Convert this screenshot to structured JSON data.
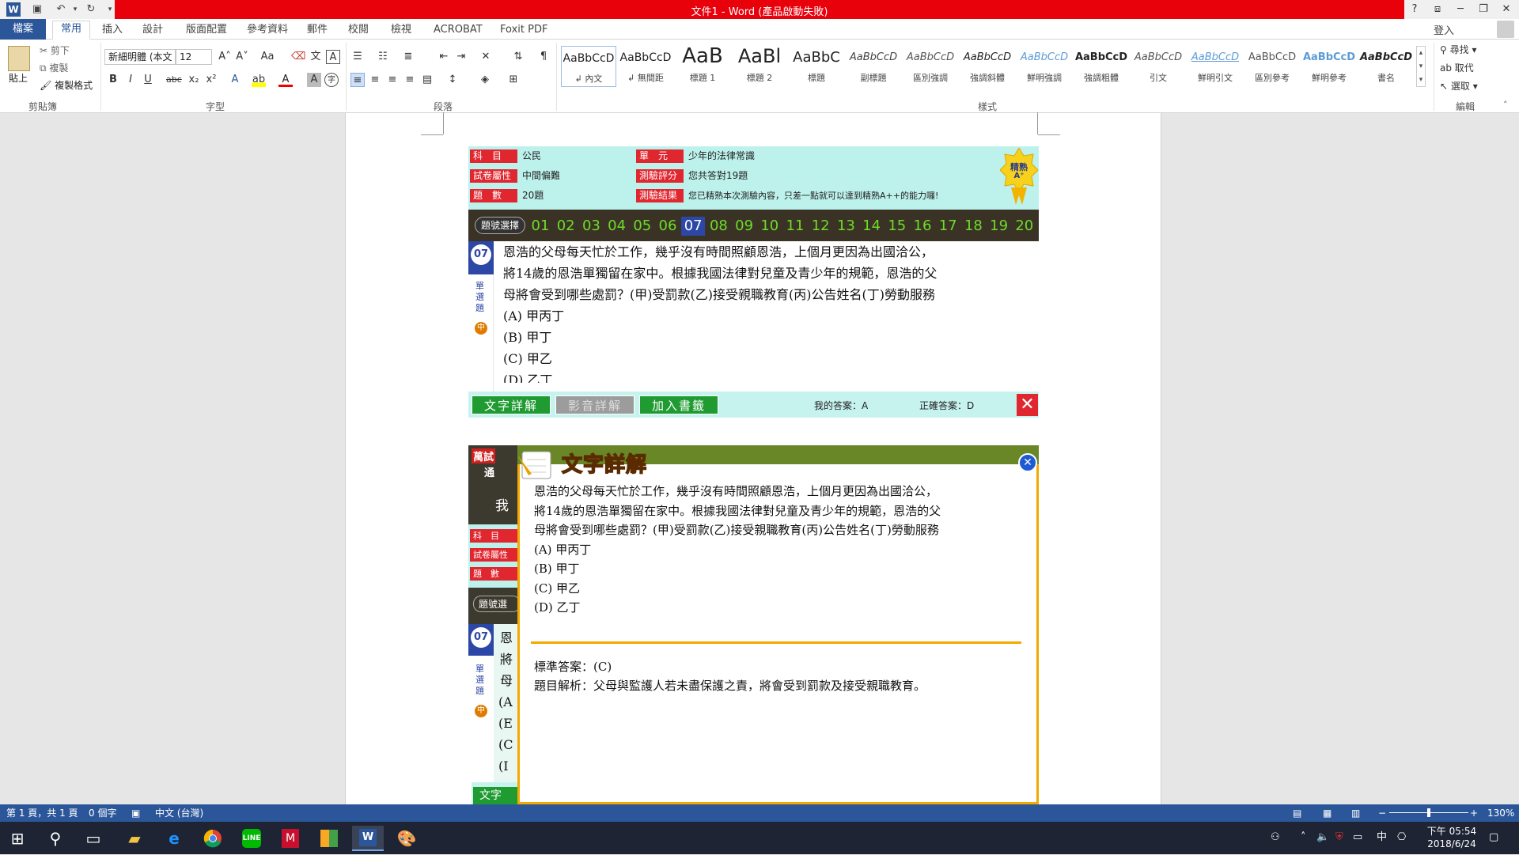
{
  "app": {
    "title": "文件1 - Word (產品啟動失敗)",
    "help": "?",
    "sign_in": "登入"
  },
  "tabs": [
    {
      "label": "檔案"
    },
    {
      "label": "常用"
    },
    {
      "label": "插入"
    },
    {
      "label": "設計"
    },
    {
      "label": "版面配置"
    },
    {
      "label": "參考資料"
    },
    {
      "label": "郵件"
    },
    {
      "label": "校閱"
    },
    {
      "label": "檢視"
    },
    {
      "label": "ACROBAT"
    },
    {
      "label": "Foxit PDF"
    }
  ],
  "ribbon": {
    "clipboard": {
      "paste": "貼上",
      "cut": "剪下",
      "copy": "複製",
      "format_painter": "複製格式",
      "label": "剪貼簿"
    },
    "font": {
      "name": "新細明體 (本文",
      "size": "12",
      "case": "Aa",
      "label": "字型"
    },
    "paragraph": {
      "label": "段落"
    },
    "styles": {
      "label": "樣式",
      "items": [
        {
          "preview": "AaBbCcD",
          "name": "↲ 內文"
        },
        {
          "preview": "AaBbCcD",
          "name": "↲ 無間距"
        },
        {
          "preview": "AaB",
          "name": "標題 1"
        },
        {
          "preview": "AaBl",
          "name": "標題 2"
        },
        {
          "preview": "AaBbC",
          "name": "標題"
        },
        {
          "preview": "AaBbCcD",
          "name": "副標題"
        },
        {
          "preview": "AaBbCcD",
          "name": "區別強調"
        },
        {
          "preview": "AaBbCcD",
          "name": "強調斜體"
        },
        {
          "preview": "AaBbCcD",
          "name": "鮮明強調"
        },
        {
          "preview": "AaBbCcD",
          "name": "強調粗體"
        },
        {
          "preview": "AaBbCcD",
          "name": "引文"
        },
        {
          "preview": "AaBbCcD",
          "name": "鮮明引文"
        },
        {
          "preview": "AaBbCcD",
          "name": "區別參考"
        },
        {
          "preview": "AaBbCcD",
          "name": "鮮明參考"
        },
        {
          "preview": "AaBbCcD",
          "name": "書名"
        }
      ]
    },
    "editing": {
      "find": "尋找",
      "replace": "取代",
      "select": "選取",
      "label": "編輯"
    }
  },
  "quiz": {
    "info": {
      "subject_label": "科　目",
      "subject": "公民",
      "unit_label": "單　元",
      "unit": "少年的法律常識",
      "level_label": "試卷屬性",
      "level": "中間偏難",
      "score_label": "測驗評分",
      "score": "您共答對19題",
      "count_label": "題　數",
      "count": "20題",
      "result_label": "測驗結果",
      "result": "您已精熟本次測驗內容，只差一點就可以達到精熟A++的能力囉!",
      "badge": "精熟",
      "badge_grade": "A⁺"
    },
    "select_label": "題號選擇",
    "numbers": [
      "01",
      "02",
      "03",
      "04",
      "05",
      "06",
      "07",
      "08",
      "09",
      "10",
      "11",
      "12",
      "13",
      "14",
      "15",
      "16",
      "17",
      "18",
      "19",
      "20"
    ],
    "current": "07",
    "qnum": "07",
    "qtype": "單選題",
    "difficulty": "中",
    "question_lines": [
      "恩浩的父母每天忙於工作，幾乎沒有時間照顧恩浩，上個月更因為出國洽公，",
      "將14歲的恩浩單獨留在家中。根據我國法律對兒童及青少年的規範，恩浩的父",
      "母將會受到哪些處罰？(甲)受罰款(乙)接受親職教育(丙)公告姓名(丁)勞動服務"
    ],
    "options": [
      "(A) 甲丙丁",
      "(B) 甲丁",
      "(C) 甲乙",
      "(D) 乙丁"
    ],
    "btn_text": "文字詳解",
    "btn_video": "影音詳解",
    "btn_bookmark": "加入書籤",
    "my_answer": "我的答案：A",
    "correct_answer": "正確答案：D"
  },
  "popup": {
    "title": "文字詳解",
    "question_lines": [
      "恩浩的父母每天忙於工作，幾乎沒有時間照顧恩浩，上個月更因為出國洽公，",
      "將14歲的恩浩單獨留在家中。根據我國法律對兒童及青少年的規範，恩浩的父",
      "母將會受到哪些處罰？(甲)受罰款(乙)接受親職教育(丙)公告姓名(丁)勞動服務"
    ],
    "options": [
      "(A) 甲丙丁",
      "(B) 甲丁",
      "(C) 甲乙",
      "(D) 乙丁"
    ],
    "answer": "標準答案：(C)",
    "analysis": "題目解析：父母與監護人若未盡保護之責，將會受到罰款及接受親職教育。",
    "bg_fragments": [
      "萬試",
      "通",
      "我",
      "科　目",
      "試卷屬性",
      "題　數",
      "題號選",
      "07",
      "恩",
      "將",
      "母",
      "(A",
      "(E",
      "(C",
      "(I",
      "單選題",
      "中",
      "文字"
    ]
  },
  "status": {
    "page": "第 1 頁，共 1 頁",
    "words": "0 個字",
    "language": "中文 (台灣)",
    "zoom": "130%"
  },
  "taskbar": {
    "time": "下午 05:54",
    "date": "2018/6/24",
    "ime": "中"
  },
  "colors": {
    "word_blue": "#2b579a",
    "title_red": "#e8000b",
    "quiz_red_label": "#e0262f",
    "quiz_green_number": "#6ddc28",
    "popup_border": "#f3a900"
  }
}
